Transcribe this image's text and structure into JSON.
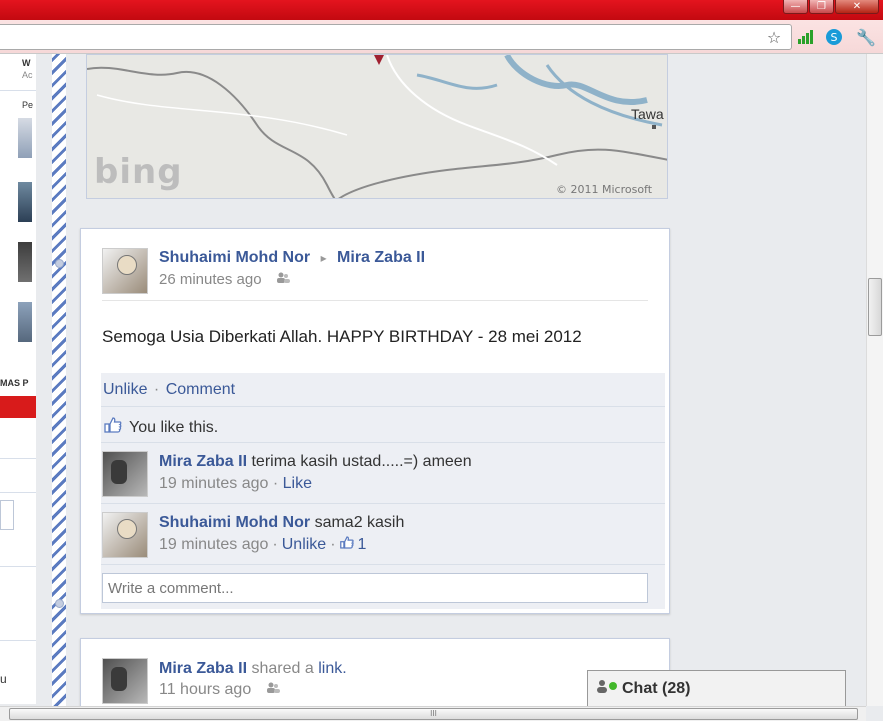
{
  "window": {
    "minimize_glyph": "—",
    "maximize_glyph": "❐",
    "close_glyph": "✕"
  },
  "toolbar_icons": [
    "star-icon",
    "signal-icon",
    "extension-icon",
    "wrench-icon"
  ],
  "left_sidebar": {
    "fragments": [
      "W",
      "Ac",
      "Pe",
      "MAS P",
      "u"
    ]
  },
  "map": {
    "place_label": "Tawa",
    "logo_text": "bing",
    "copyright": "© 2011 Microsoft"
  },
  "post": {
    "author": "Shuhaimi Mohd Nor",
    "arrow": "▸",
    "target": "Mira Zaba II",
    "time": "26 minutes ago",
    "message": "Semoga Usia Diberkati Allah. HAPPY BIRTHDAY - 28 mei 2012",
    "actions": {
      "unlike": "Unlike",
      "comment": "Comment",
      "separator": "·"
    },
    "likes_text": "You like this.",
    "comments": [
      {
        "author": "Mira Zaba II",
        "text": "terima kasih ustad.....=) ameen",
        "time": "19 minutes ago",
        "action": "Like",
        "like_count": ""
      },
      {
        "author": "Shuhaimi Mohd Nor",
        "text": "sama2 kasih",
        "time": "19 minutes ago",
        "action": "Unlike",
        "like_count": "1"
      }
    ],
    "comment_placeholder": "Write a comment..."
  },
  "post2": {
    "author": "Mira Zaba II",
    "shared": "shared a",
    "link": "link.",
    "time": "11 hours ago"
  },
  "chat": {
    "label": "Chat (28)"
  },
  "scroll_grip": "III",
  "colors": {
    "brand": "#3b5998",
    "titlebar": "#d8141d"
  }
}
